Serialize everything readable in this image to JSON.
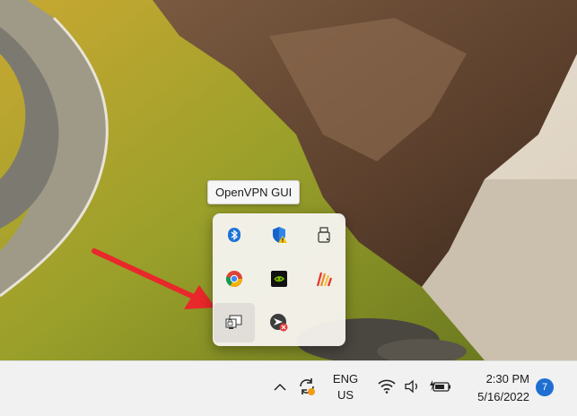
{
  "tooltip": {
    "text": "OpenVPN GUI"
  },
  "overflow_tray": {
    "icons": [
      {
        "name": "bluetooth-icon"
      },
      {
        "name": "windows-security-icon"
      },
      {
        "name": "usb-eject-icon"
      },
      {
        "name": "chrome-icon"
      },
      {
        "name": "nvidia-icon"
      },
      {
        "name": "stripes-app-icon"
      },
      {
        "name": "openvpn-gui-icon"
      },
      {
        "name": "snipping-tool-icon"
      }
    ]
  },
  "taskbar": {
    "language_line1": "ENG",
    "language_line2": "US",
    "time": "2:30 PM",
    "date": "5/16/2022",
    "notification_count": "7"
  },
  "colors": {
    "accent": "#1f6fd1",
    "arrow": "#e8282b",
    "taskbar_bg": "#f1f1f1"
  }
}
